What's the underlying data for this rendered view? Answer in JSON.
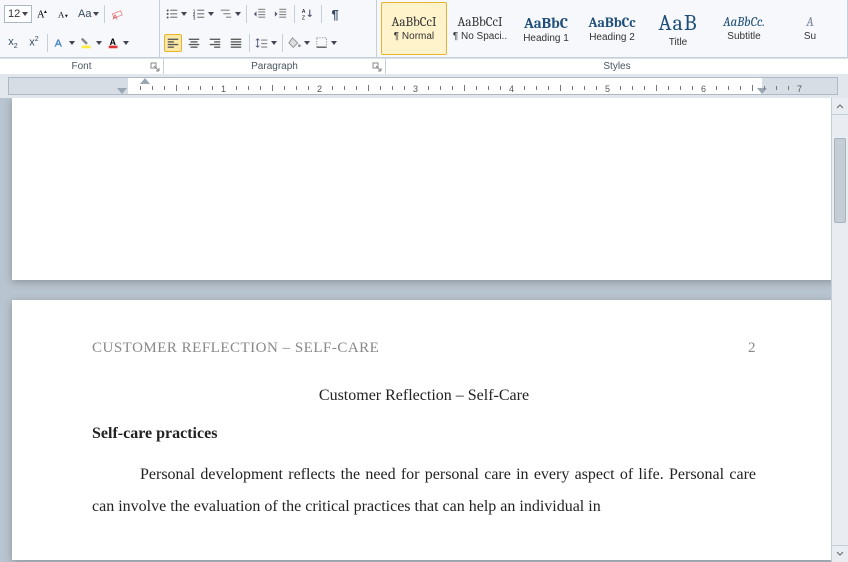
{
  "ribbon": {
    "font": {
      "size": "12",
      "label": "Font"
    },
    "paragraph": {
      "label": "Paragraph"
    },
    "styles": {
      "label": "Styles",
      "items": [
        {
          "preview": "AaBbCcI",
          "name": "¶ Normal",
          "cls": "normal",
          "selected": true
        },
        {
          "preview": "AaBbCcI",
          "name": "¶ No Spaci..",
          "cls": "normal",
          "selected": false
        },
        {
          "preview": "AaBbC",
          "name": "Heading 1",
          "cls": "h1",
          "selected": false
        },
        {
          "preview": "AaBbCc",
          "name": "Heading 2",
          "cls": "h2",
          "selected": false
        },
        {
          "preview": "AaB",
          "name": "Title",
          "cls": "title",
          "selected": false
        },
        {
          "preview": "AaBbCc.",
          "name": "Subtitle",
          "cls": "sub",
          "selected": false
        },
        {
          "preview": "A",
          "name": "Su",
          "cls": "more",
          "selected": false
        }
      ]
    }
  },
  "ruler": {
    "numbers": [
      "1",
      "2",
      "3",
      "4",
      "5",
      "6",
      "7"
    ]
  },
  "document": {
    "running_head": "CUSTOMER REFLECTION – SELF-CARE",
    "page_number": "2",
    "title": "Customer Reflection – Self-Care",
    "section_heading": "Self-care practices",
    "body": "Personal development reflects the need for personal care in every aspect of life. Personal care can involve the evaluation of the critical practices that can help an individual in"
  }
}
